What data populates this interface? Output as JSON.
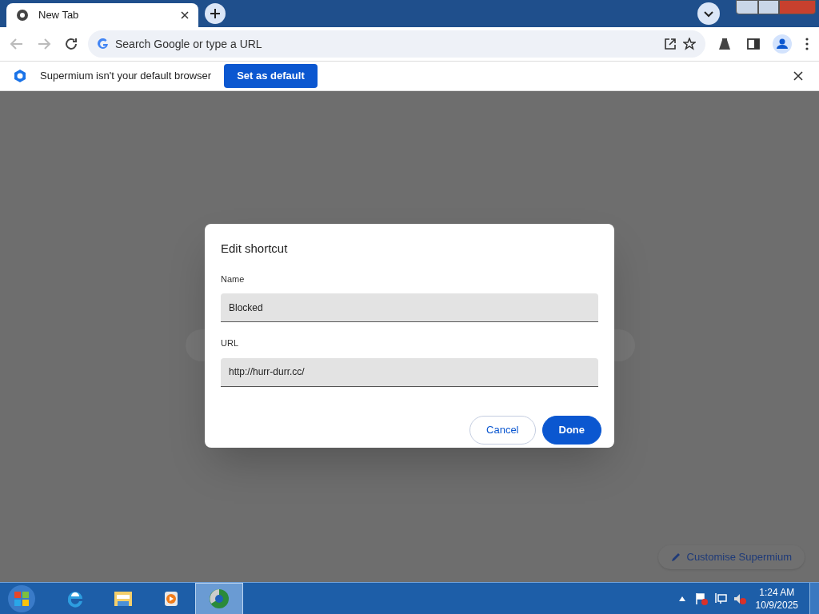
{
  "tab": {
    "title": "New Tab",
    "selected": true
  },
  "omnibox": {
    "placeholder": "Search Google or type a URL"
  },
  "infobar": {
    "message": "Supermium isn't your default browser",
    "button": "Set as default"
  },
  "dialog": {
    "title": "Edit shortcut",
    "fields": [
      {
        "label": "Name",
        "value": "Blocked"
      },
      {
        "label": "URL",
        "value": "http://hurr-durr.cc/"
      }
    ],
    "buttons": [
      {
        "label": "Cancel",
        "kind": "secondary"
      },
      {
        "label": "Done",
        "kind": "primary"
      }
    ]
  },
  "customise_button": "Customise Supermium",
  "taskbar": {
    "apps": [
      {
        "kind": "ie",
        "selected": false
      },
      {
        "kind": "folder",
        "selected": false
      },
      {
        "kind": "media",
        "selected": false
      },
      {
        "kind": "browser",
        "selected": true
      }
    ],
    "time": "1:24 AM",
    "date": "10/9/2025"
  }
}
